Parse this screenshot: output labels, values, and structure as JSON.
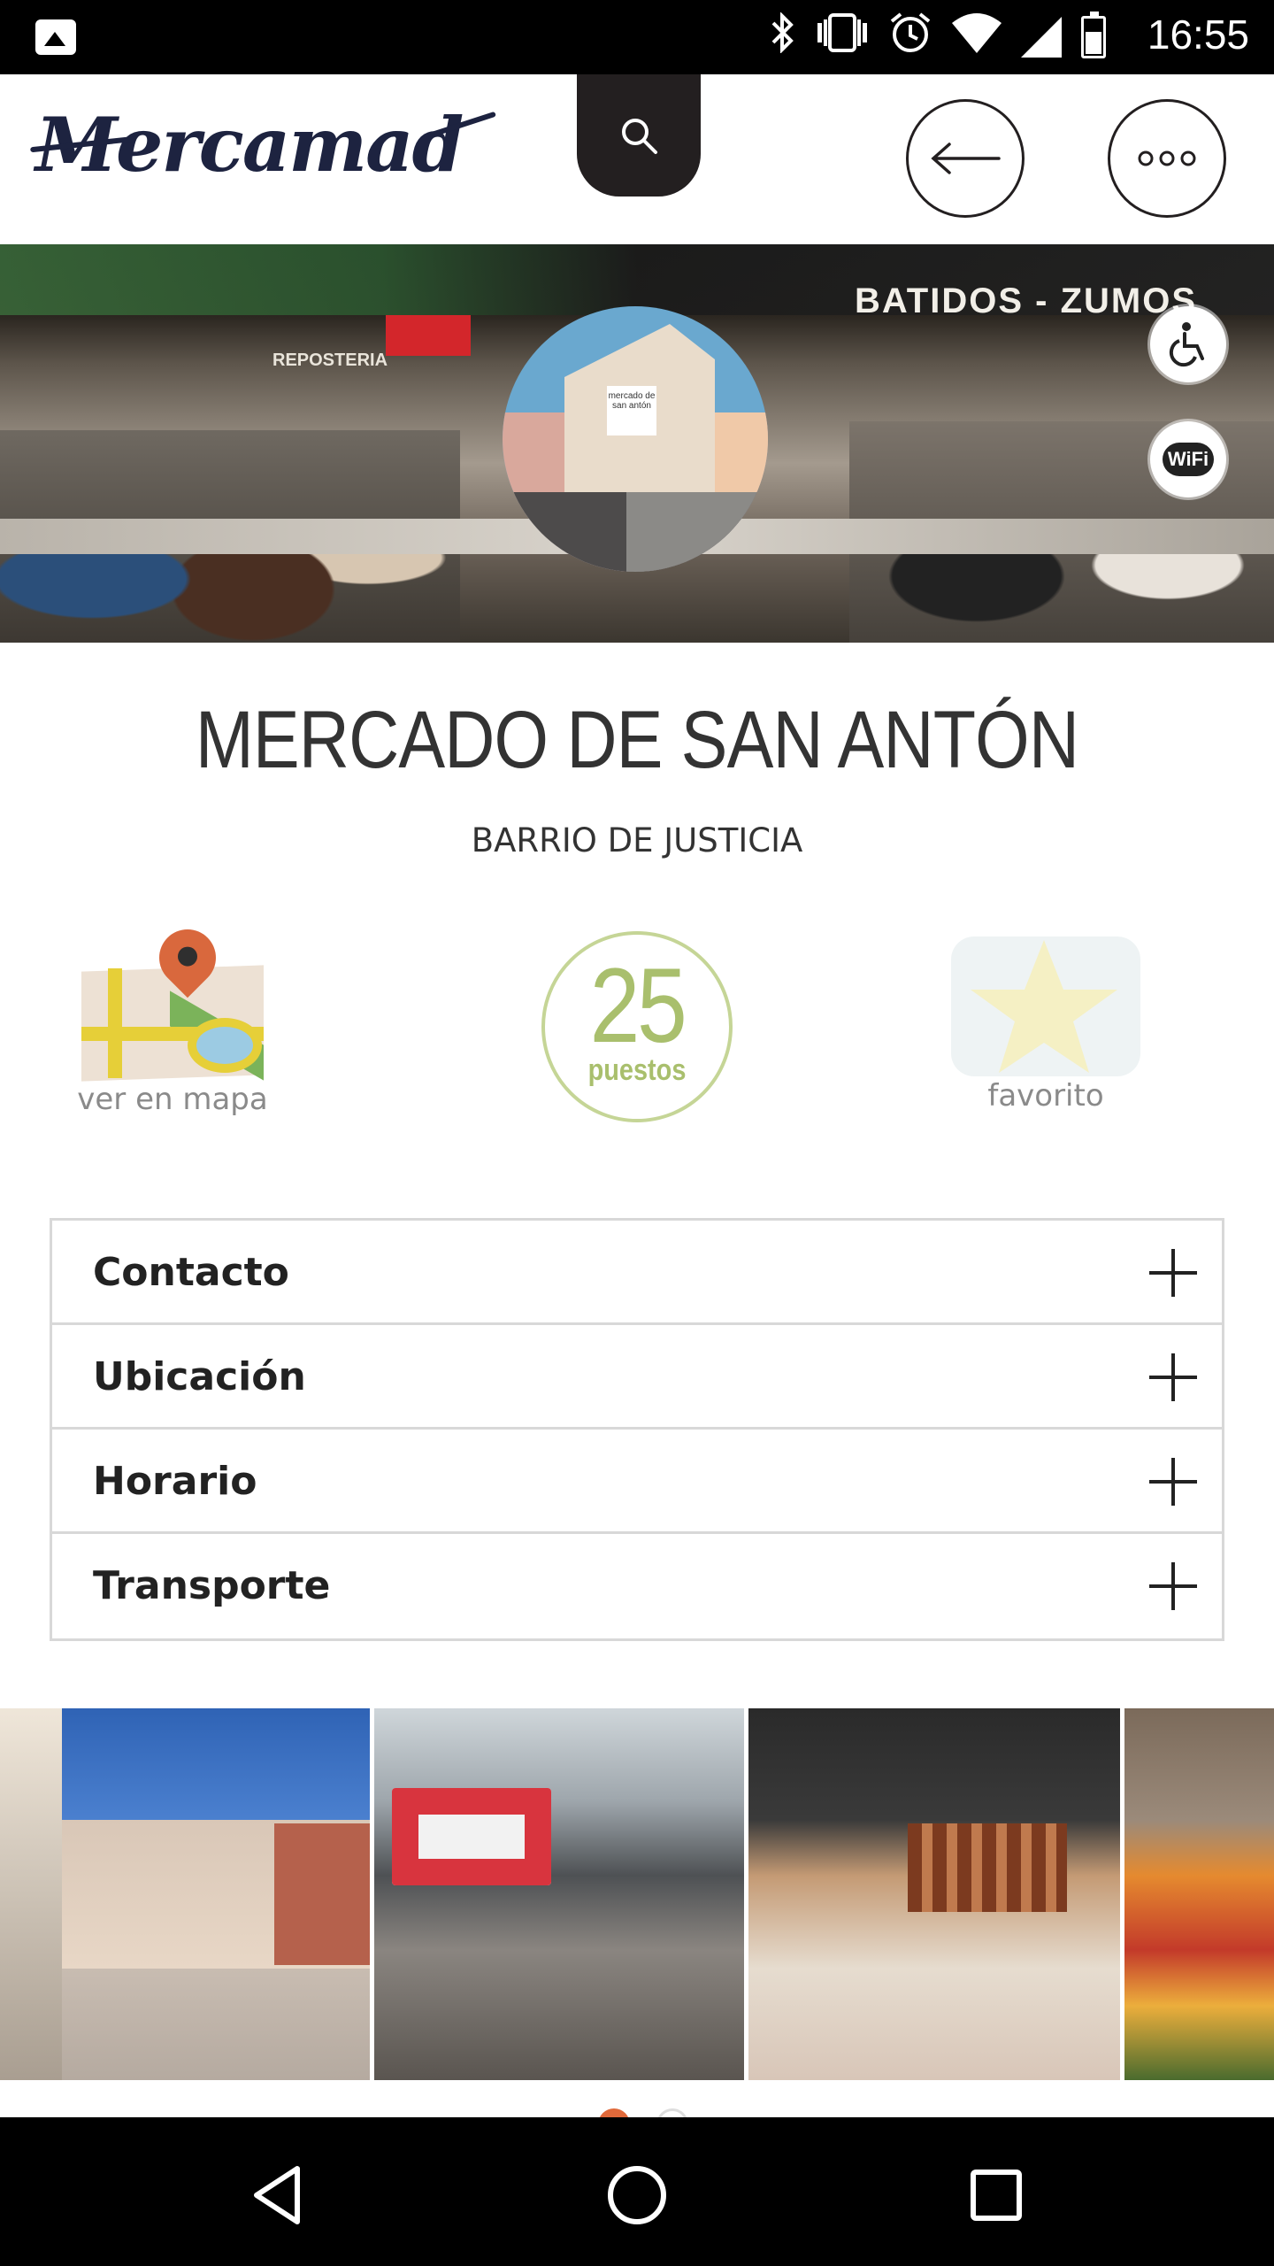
{
  "status_bar": {
    "time": "16:55",
    "icons": [
      "gallery-icon",
      "bluetooth-icon",
      "vibrate-icon",
      "alarm-icon",
      "wifi-icon",
      "signal-icon",
      "battery-icon"
    ]
  },
  "header": {
    "logo": "Mercamad",
    "icons": [
      "search-icon",
      "arrow-left-icon",
      "more-horizontal-icon"
    ]
  },
  "hero": {
    "signs": {
      "right": "BATIDOS - ZUMOS",
      "left": "REPOSTERIA"
    },
    "badge_text": "mercado de san antón",
    "amenities": [
      "wheelchair-icon",
      "wifi-icon"
    ],
    "wifi_label": "WiFi"
  },
  "market": {
    "title": "MERCADO DE SAN ANTÓN",
    "subtitle": "BARRIO DE JUSTICIA"
  },
  "actions": {
    "map_label": "ver en mapa",
    "stalls_count": "25",
    "stalls_label": "puestos",
    "favorite_label": "favorito"
  },
  "accordion": {
    "items": [
      {
        "label": "Contacto"
      },
      {
        "label": "Ubicación"
      },
      {
        "label": "Horario"
      },
      {
        "label": "Transporte"
      }
    ]
  },
  "gallery": {
    "photo_count_visible": 4,
    "current_page": 1,
    "page_count": 2
  },
  "colors": {
    "accent_orange": "#e0693a",
    "stalls_green": "#a9bf6d",
    "logo_navy": "#1d2340",
    "dark": "#231f20"
  },
  "nav_bar": {
    "icons": [
      "back-triangle-icon",
      "home-circle-icon",
      "recents-square-icon"
    ]
  }
}
